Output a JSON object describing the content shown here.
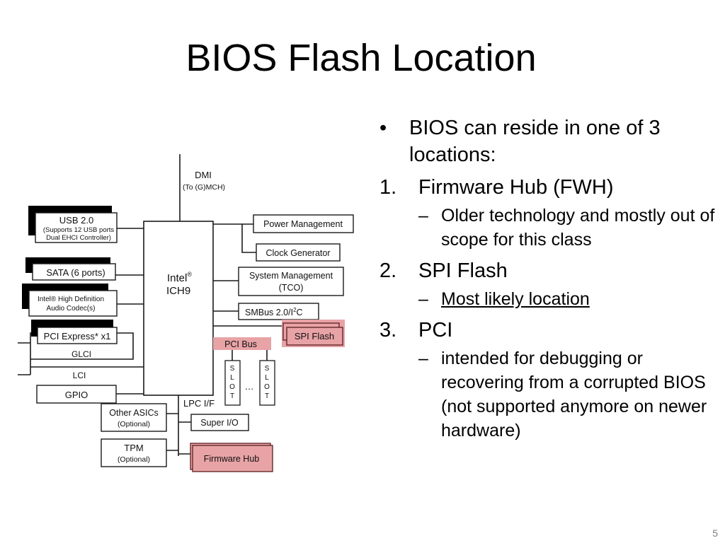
{
  "slide": {
    "title": "BIOS Flash Location",
    "page_number": "5"
  },
  "diagram": {
    "hub": {
      "line1": "Intel",
      "reg": "®",
      "line2": "ICH9"
    },
    "dmi": {
      "label": "DMI",
      "sublabel": "(To (G)MCH)"
    },
    "left_blocks": {
      "usb": {
        "line1": "USB 2.0",
        "line2": "(Supports 12 USB ports",
        "line3": "Dual EHCI Controller)"
      },
      "sata": {
        "line1": "SATA (6 ports)"
      },
      "audio": {
        "line1": "Intel® High Definition",
        "line2": "Audio Codec(s)"
      },
      "pcie": {
        "line1": "PCI Express* x1"
      },
      "glci": "GLCI",
      "lci": "LCI",
      "gpio": "GPIO",
      "other_asics": {
        "line1": "Other ASICs",
        "line2": "(Optional)"
      },
      "tpm": {
        "line1": "TPM",
        "line2": "(Optional)"
      }
    },
    "right_blocks": {
      "power_mgmt": "Power Management",
      "clock_gen": "Clock Generator",
      "sys_mgmt": {
        "line1": "System Management",
        "line2": "(TCO)"
      },
      "smbus": {
        "pre": "SMBus 2.0/I",
        "sup": "2",
        "post": "C"
      },
      "spi_flash": "SPI Flash",
      "pci_bus": "PCI Bus",
      "slot_letters": [
        "S",
        "L",
        "O",
        "T"
      ],
      "ellipsis": "…",
      "lpc": "LPC I/F",
      "super_io": "Super I/O",
      "firmware_hub": "Firmware Hub"
    },
    "colors": {
      "highlight_fill": "#e8a3a6",
      "highlight_stroke": "#8b2a2e",
      "line": "#1a1a1a"
    }
  },
  "bullets": {
    "intro": {
      "mark": "•",
      "text": "BIOS can reside in one of 3 locations:"
    },
    "items": [
      {
        "mark": "1.",
        "text": "Firmware Hub (FWH)",
        "sub": {
          "mark": "–",
          "text": "Older technology and mostly out of scope for this class",
          "underline": false
        }
      },
      {
        "mark": "2.",
        "text": "SPI Flash",
        "sub": {
          "mark": "–",
          "text": "Most likely location",
          "underline": true
        }
      },
      {
        "mark": "3.",
        "text": "PCI",
        "sub": {
          "mark": "–",
          "text": "intended for debugging or recovering from a corrupted BIOS (not supported anymore on newer hardware)",
          "underline": false
        }
      }
    ]
  }
}
